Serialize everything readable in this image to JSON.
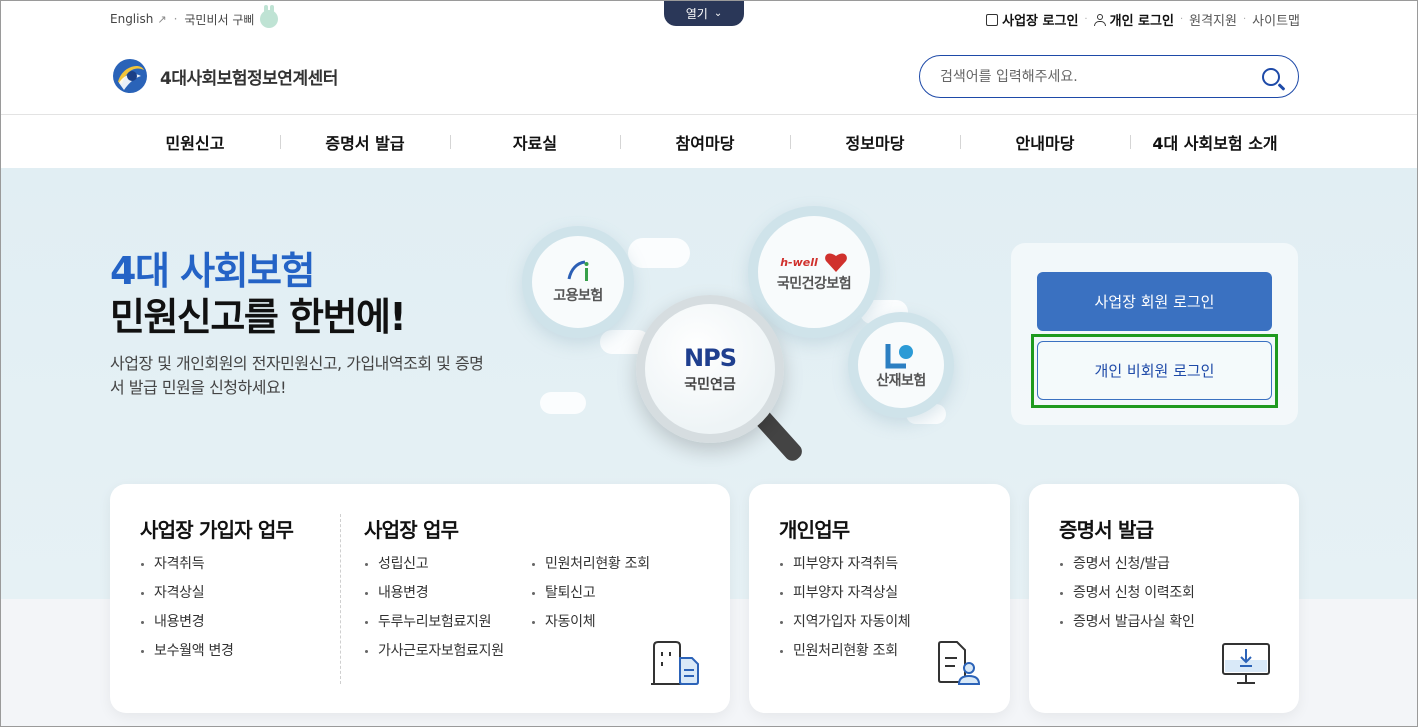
{
  "util": {
    "english": "English",
    "secretary": "국민비서 구삐",
    "open_tab": "열기",
    "biz_login": "사업장 로그인",
    "personal_login": "개인 로그인",
    "remote": "원격지원",
    "sitemap": "사이트맵"
  },
  "logo_text": "4대사회보험정보연계센터",
  "search": {
    "placeholder": "검색어를 입력해주세요."
  },
  "gnb": [
    "민원신고",
    "증명서 발급",
    "자료실",
    "참여마당",
    "정보마당",
    "안내마당",
    "4대 사회보험 소개"
  ],
  "hero": {
    "title_line1": "4대 사회보험",
    "title_line2": "민원신고를 한번에!",
    "desc": "사업장 및 개인회원의 전자민원신고, 가입내역조회 및 증명서 발급 민원을 신청하세요!"
  },
  "insurers": {
    "employment": "고용보험",
    "health_brand": "h-well",
    "health": "국민건강보험",
    "pension_brand": "NPS",
    "pension": "국민연금",
    "accident": "산재보험"
  },
  "login": {
    "biz_button": "사업장 회원 로그인",
    "personal_button": "개인 비회원 로그인"
  },
  "cards": {
    "biz_member": {
      "title": "사업장 가입자 업무",
      "items": [
        "자격취득",
        "자격상실",
        "내용변경",
        "보수월액 변경"
      ]
    },
    "biz": {
      "title": "사업장 업무",
      "col1": [
        "성립신고",
        "내용변경",
        "두루누리보험료지원",
        "가사근로자보험료지원"
      ],
      "col2": [
        "민원처리현황 조회",
        "탈퇴신고",
        "자동이체"
      ]
    },
    "personal": {
      "title": "개인업무",
      "items": [
        "피부양자 자격취득",
        "피부양자 자격상실",
        "지역가입자 자동이체",
        "민원처리현황 조회"
      ]
    },
    "cert": {
      "title": "증명서 발급",
      "items": [
        "증명서 신청/발급",
        "증명서 신청 이력조회",
        "증명서 발급사실 확인"
      ]
    }
  },
  "colors": {
    "primary": "#3a71c1",
    "navy": "#2a3758",
    "highlight": "#1f9a1f"
  }
}
